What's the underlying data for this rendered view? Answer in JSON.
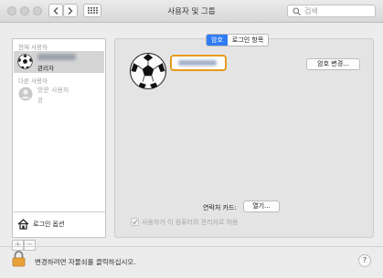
{
  "window": {
    "title": "사용자 및 그룹"
  },
  "search": {
    "placeholder": "검색"
  },
  "sidebar": {
    "current_users_header": "현재 사용자",
    "current_user": {
      "name": "",
      "role": "관리자"
    },
    "other_users_header": "다른 사용자",
    "guest_user": {
      "name": "방문 사용자",
      "status": "끔"
    },
    "login_options_label": "로그인 옵션",
    "add_label": "+",
    "remove_label": "−"
  },
  "tabs": [
    {
      "label": "암호",
      "selected": true
    },
    {
      "label": "로그인 항목",
      "selected": false
    }
  ],
  "main": {
    "full_name": "",
    "change_password_label": "암호 변경...",
    "contact_card_label": "연락처 카드:",
    "open_button_label": "열기...",
    "admin_checkbox_label": "사용자가 이 컴퓨터의 관리자로 허용",
    "admin_checked": true
  },
  "footer": {
    "lock_text": "변경하려면 자물쇠를 클릭하십시오.",
    "help_label": "?"
  },
  "colors": {
    "accent": "#2f7bf5",
    "focus_ring": "#e69a1c"
  }
}
